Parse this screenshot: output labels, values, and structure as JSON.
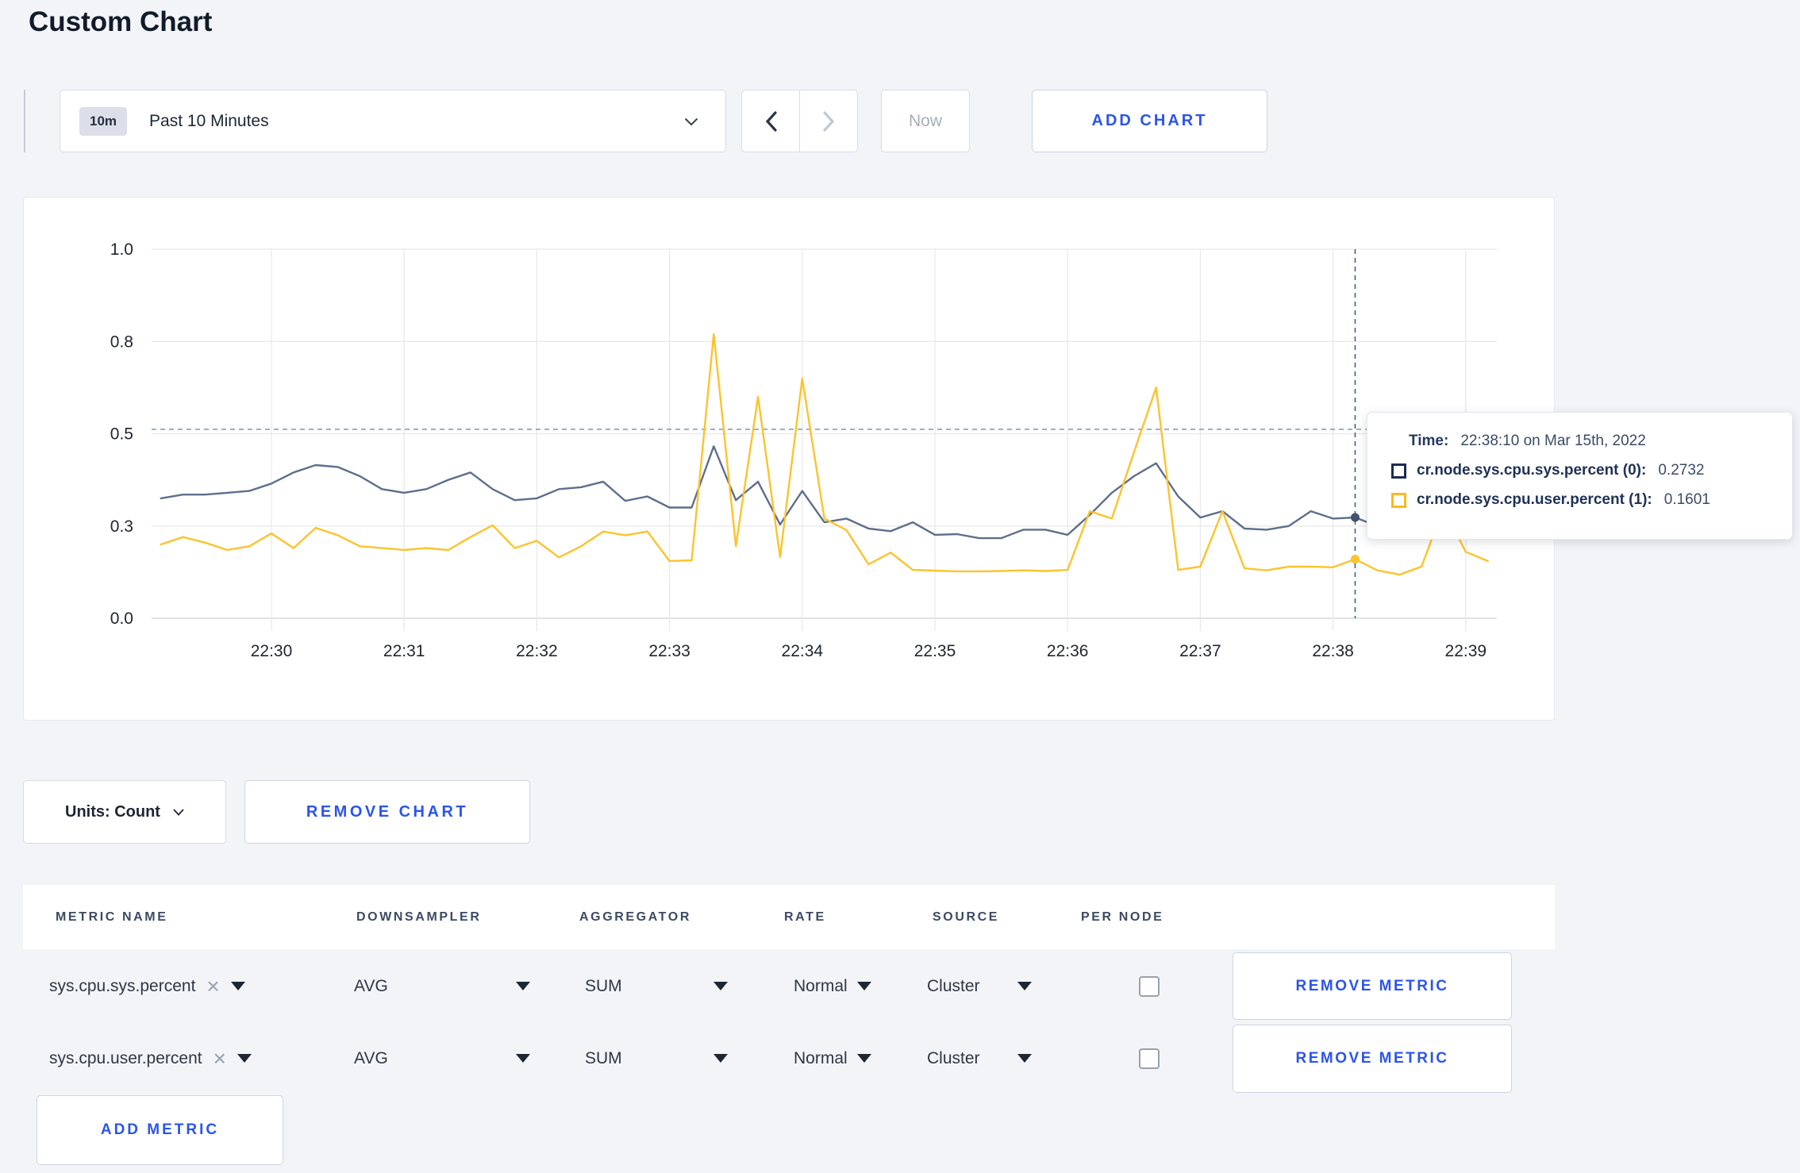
{
  "page": {
    "title": "Custom Chart"
  },
  "toolbar": {
    "range_badge": "10m",
    "range_label": "Past 10 Minutes",
    "now_label": "Now",
    "add_chart_label": "ADD CHART"
  },
  "chart_data": {
    "type": "line",
    "title": "",
    "y_axis": {
      "ylim": [
        0,
        1
      ],
      "tick_values": [
        0,
        0.25,
        0.5,
        0.75,
        1
      ],
      "tick_labels": [
        "0.0",
        "0.3",
        "0.5",
        "0.8",
        "1.0"
      ]
    },
    "x_axis": {
      "tick_labels": [
        "22:30",
        "22:31",
        "22:32",
        "22:33",
        "22:34",
        "22:35",
        "22:36",
        "22:37",
        "22:38",
        "22:39"
      ],
      "start_time": "22:29:10",
      "interval_seconds": 10,
      "seconds_before_first_tick": 50
    },
    "grid": true,
    "series": [
      {
        "name": "cr.node.sys.cpu.sys.percent",
        "color": "#5f6e8c",
        "legend_color": "#1c2b4e",
        "values": [
          0.325,
          0.335,
          0.335,
          0.34,
          0.345,
          0.365,
          0.395,
          0.415,
          0.41,
          0.385,
          0.35,
          0.34,
          0.35,
          0.375,
          0.395,
          0.35,
          0.32,
          0.325,
          0.35,
          0.355,
          0.37,
          0.318,
          0.33,
          0.3,
          0.3,
          0.466,
          0.32,
          0.37,
          0.254,
          0.345,
          0.26,
          0.27,
          0.243,
          0.236,
          0.26,
          0.226,
          0.228,
          0.217,
          0.217,
          0.24,
          0.24,
          0.226,
          0.28,
          0.34,
          0.385,
          0.42,
          0.33,
          0.273,
          0.29,
          0.243,
          0.24,
          0.25,
          0.29,
          0.27,
          0.2732,
          0.25,
          0.28,
          0.29,
          0.28,
          0.285,
          0.28
        ]
      },
      {
        "name": "cr.node.sys.cpu.user.percent",
        "color": "#fcc32c",
        "legend_color": "#fdb91e",
        "values": [
          0.2,
          0.22,
          0.205,
          0.185,
          0.195,
          0.23,
          0.19,
          0.245,
          0.225,
          0.195,
          0.19,
          0.185,
          0.19,
          0.185,
          0.22,
          0.252,
          0.19,
          0.21,
          0.165,
          0.195,
          0.235,
          0.225,
          0.235,
          0.155,
          0.157,
          0.77,
          0.196,
          0.6,
          0.166,
          0.65,
          0.27,
          0.239,
          0.146,
          0.178,
          0.131,
          0.129,
          0.127,
          0.127,
          0.128,
          0.13,
          0.128,
          0.131,
          0.29,
          0.27,
          0.45,
          0.625,
          0.131,
          0.14,
          0.29,
          0.135,
          0.13,
          0.14,
          0.14,
          0.138,
          0.1601,
          0.13,
          0.118,
          0.14,
          0.3,
          0.18,
          0.155
        ]
      }
    ],
    "crosshair": {
      "index": 54,
      "time": "22:38:10",
      "hover_value": 0.512,
      "v_color": "#40627e",
      "h_color": "#6f8fa9"
    },
    "tooltip": {
      "time_label": "Time:",
      "time_value": "22:38:10 on Mar 15th, 2022",
      "entries": [
        {
          "name": "cr.node.sys.cpu.sys.percent (0):",
          "value": "0.2732"
        },
        {
          "name": "cr.node.sys.cpu.user.percent (1):",
          "value": "0.1601"
        }
      ]
    }
  },
  "chart_controls": {
    "units_label": "Units: Count",
    "remove_chart_label": "REMOVE CHART"
  },
  "metrics_table": {
    "headers": [
      "METRIC NAME",
      "DOWNSAMPLER",
      "AGGREGATOR",
      "RATE",
      "SOURCE",
      "PER NODE"
    ],
    "remove_metric_label": "REMOVE METRIC",
    "add_metric_label": "ADD METRIC",
    "rows": [
      {
        "metric": "sys.cpu.sys.percent",
        "downsampler": "AVG",
        "aggregator": "SUM",
        "rate": "Normal",
        "source": "Cluster",
        "per_node_checked": false
      },
      {
        "metric": "sys.cpu.user.percent",
        "downsampler": "AVG",
        "aggregator": "SUM",
        "rate": "Normal",
        "source": "Cluster",
        "per_node_checked": false
      }
    ]
  },
  "colors": {
    "accent_blue": "#2b54ed",
    "page_bg": "#f3f4f8",
    "grid": "#e8e8ea",
    "axis": "#d5d8dc"
  }
}
